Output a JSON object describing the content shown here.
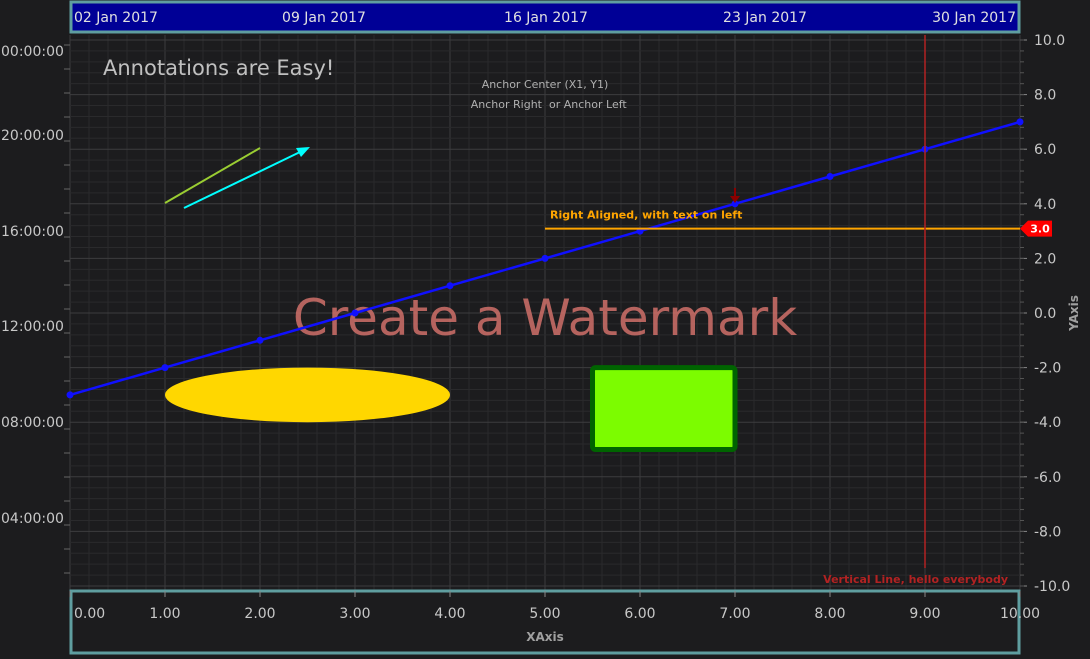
{
  "chart_data": {
    "type": "line",
    "title": "",
    "xlabel": "XAxis",
    "ylabel": "YAxis",
    "x_ticks": [
      "0.00",
      "1.00",
      "2.00",
      "3.00",
      "4.00",
      "5.00",
      "6.00",
      "7.00",
      "8.00",
      "9.00",
      "10.00"
    ],
    "xlim": [
      -0.2,
      10.2
    ],
    "y_ticks": [
      "10.0",
      "8.0",
      "6.0",
      "4.0",
      "2.0",
      "0.0",
      "-2.0",
      "-4.0",
      "-6.0",
      "-8.0",
      "-10.0"
    ],
    "ylim": [
      -10.0,
      10.0
    ],
    "top_axis_ticks": [
      "02 Jan 2017",
      "09 Jan 2017",
      "16 Jan 2017",
      "23 Jan 2017",
      "30 Jan 2017"
    ],
    "left_axis_ticks": [
      "00:00:00",
      "20:00:00",
      "16:00:00",
      "12:00:00",
      "08:00:00",
      "04:00:00"
    ],
    "series": [
      {
        "x": [
          0,
          1,
          2,
          3,
          4,
          5,
          6,
          7,
          8,
          9,
          10
        ],
        "y": [
          -3.0,
          -2.0,
          -1.0,
          0.0,
          1.0,
          2.0,
          3.0,
          4.0,
          5.0,
          6.0,
          7.0
        ]
      }
    ],
    "annotations": {
      "header_text": "Annotations are Easy!",
      "anchor_center_text": "Anchor Center (X1, Y1)",
      "anchor_right_text": "Anchor Right",
      "anchor_left_text": "or Anchor Left",
      "watermark_text": "Create a Watermark",
      "horizontal_line_text": "Right Aligned, with text on left",
      "horizontal_line_y": 3.2,
      "horizontal_line_x_start": 5.0,
      "horizontal_line_axis_label": "3.0",
      "vertical_line_text": "Vertical Line, hello everybody",
      "vertical_line_x": 9.0,
      "ellipse": {
        "x1": 1.0,
        "x2": 4.0,
        "y1": -2.0,
        "y2": -4.0
      },
      "box": {
        "x1": 5.5,
        "x2": 7.0,
        "y1": -2.0,
        "y2": -5.0
      },
      "line_annotation": {
        "x1": 0.0,
        "y1": 4.0,
        "x2": 1.0,
        "y2": 6.0
      },
      "arrow_annotation": {
        "x1": 0.2,
        "y1": 3.6,
        "x2": 1.5,
        "y2": 6.0
      },
      "marker_x": 7.0
    },
    "colors": {
      "series": "#1010ff",
      "horizontal_line": "#ffa500",
      "vertical_line": "#b22222",
      "ellipse": "#ffd700",
      "box_fill": "#7cfc00",
      "box_border": "#006400",
      "line_annotation": "#9acd32",
      "arrow_annotation": "#00ffff",
      "watermark": "#d0706a",
      "axis_panel": "#000096",
      "axis_panel_border": "#5f9ea0",
      "axis_badge": "#ff0000"
    }
  }
}
